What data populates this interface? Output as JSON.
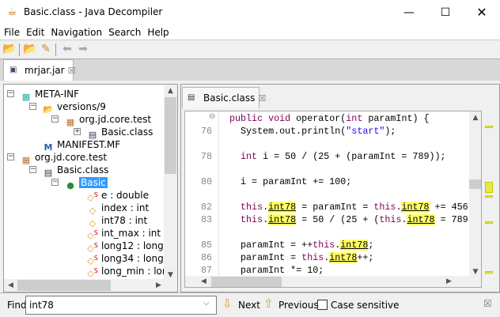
{
  "window": {
    "title": "Basic.class - Java Decompiler",
    "controls": [
      "minimize",
      "maximize",
      "close"
    ]
  },
  "menu": [
    "File",
    "Edit",
    "Navigation",
    "Search",
    "Help"
  ],
  "toolbar": {
    "icons": [
      "open-file-icon",
      "open-type-icon",
      "search-icon",
      "back-icon",
      "forward-icon"
    ]
  },
  "tabs": [
    {
      "label": "mrjar.jar"
    }
  ],
  "tree": [
    {
      "label": "META-INF",
      "icon": "package-folder-icon",
      "level": 0,
      "expander": "-"
    },
    {
      "label": "versions/9",
      "icon": "folder-open-icon",
      "level": 1,
      "expander": "-"
    },
    {
      "label": "org.jd.core.test",
      "icon": "package-icon",
      "level": 2,
      "expander": "-"
    },
    {
      "label": "Basic.class",
      "icon": "class-file-icon",
      "level": 3,
      "expander": "+"
    },
    {
      "label": "MANIFEST.MF",
      "icon": "manifest-icon",
      "level": 1,
      "expander": ""
    },
    {
      "label": "org.jd.core.test",
      "icon": "package-icon",
      "level": 0,
      "expander": "-"
    },
    {
      "label": "Basic.class",
      "icon": "class-file-icon",
      "level": 1,
      "expander": "-"
    },
    {
      "label": "Basic",
      "icon": "class-icon",
      "level": 2,
      "expander": "-",
      "selected": true
    },
    {
      "label": "e : double",
      "icon": "static-field-icon",
      "level": 3
    },
    {
      "label": "index : int",
      "icon": "field-icon",
      "level": 3
    },
    {
      "label": "int78 : int",
      "icon": "field-icon",
      "level": 3
    },
    {
      "label": "int_max : int",
      "icon": "static-field-icon",
      "level": 3
    },
    {
      "label": "long12 : long",
      "icon": "static-field-icon",
      "level": 3
    },
    {
      "label": "long34 : long",
      "icon": "static-field-icon",
      "level": 3
    },
    {
      "label": "long_min : long",
      "icon": "static-field-icon",
      "level": 3
    }
  ],
  "editor": {
    "tab": "Basic.class",
    "lines": [
      {
        "n": "",
        "code": [
          [
            "kw",
            "public void "
          ],
          [
            "",
            "operator("
          ],
          [
            "kw",
            "int "
          ],
          [
            "",
            "paramInt) {"
          ]
        ]
      },
      {
        "n": "76",
        "code": [
          [
            "",
            "  System.out.println("
          ],
          [
            "str",
            "\"start\""
          ],
          [
            "",
            ");"
          ]
        ]
      },
      {
        "n": "",
        "code": []
      },
      {
        "n": "78",
        "code": [
          [
            "kw",
            "  int "
          ],
          [
            "",
            "i = 50 / (25 + (paramInt = 789));"
          ]
        ]
      },
      {
        "n": "",
        "code": []
      },
      {
        "n": "80",
        "code": [
          [
            "",
            "  i = paramInt += 100;"
          ]
        ]
      },
      {
        "n": "",
        "code": []
      },
      {
        "n": "82",
        "code": [
          [
            "kw",
            "  this"
          ],
          [
            "",
            "."
          ],
          [
            "hl",
            "int78"
          ],
          [
            "",
            " = paramInt = "
          ],
          [
            "kw",
            "this"
          ],
          [
            "",
            "."
          ],
          [
            "hl",
            "int78"
          ],
          [
            "",
            " += 456"
          ]
        ]
      },
      {
        "n": "83",
        "code": [
          [
            "kw",
            "  this"
          ],
          [
            "",
            "."
          ],
          [
            "hl",
            "int78"
          ],
          [
            "",
            " = 50 / (25 + ("
          ],
          [
            "kw",
            "this"
          ],
          [
            "",
            "."
          ],
          [
            "hl",
            "int78"
          ],
          [
            "",
            " = 789"
          ]
        ]
      },
      {
        "n": "",
        "code": []
      },
      {
        "n": "85",
        "code": [
          [
            "",
            "  paramInt = ++"
          ],
          [
            "kw",
            "this"
          ],
          [
            "",
            "."
          ],
          [
            "hl",
            "int78"
          ],
          [
            "",
            ";"
          ]
        ]
      },
      {
        "n": "86",
        "code": [
          [
            "",
            "  paramInt = "
          ],
          [
            "kw",
            "this"
          ],
          [
            "",
            "."
          ],
          [
            "hl",
            "int78"
          ],
          [
            "",
            "++;"
          ]
        ]
      },
      {
        "n": "87",
        "code": [
          [
            "",
            "  paramInt *= 10;"
          ]
        ]
      }
    ]
  },
  "find": {
    "label": "Find:",
    "value": "int78",
    "next": "Next",
    "previous": "Previous",
    "case_sensitive": "Case sensitive",
    "case_checked": false
  },
  "colors": {
    "keyword": "#7f0055",
    "string": "#2a00ff",
    "highlight": "#ffff66",
    "selection": "#3399ff"
  }
}
